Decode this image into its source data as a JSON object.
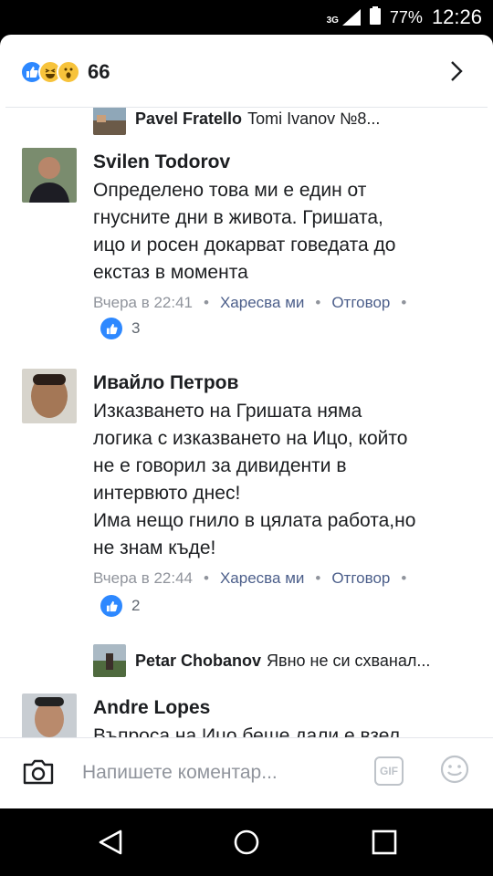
{
  "status_bar": {
    "network": "3G",
    "battery": "77%",
    "time": "12:26"
  },
  "header": {
    "reaction_count": "66",
    "reactions": [
      "like-icon",
      "haha-icon",
      "wow-icon"
    ]
  },
  "reply_previews": [
    {
      "author": "Pavel Fratello",
      "text": "Tomi Ivanov №8..."
    },
    {
      "author": "Petar Chobanov",
      "text": "Явно не си схванал..."
    }
  ],
  "comments": [
    {
      "author": "Svilen Todorov",
      "text": "Определено това ми е един от\nгнусните дни в живота. Гришата,\nицо и росен докарват говедата до\nекстаз в момента",
      "time": "Вчера в 22:41",
      "like_label": "Харесва ми",
      "reply_label": "Отговор",
      "likes": "3"
    },
    {
      "author": "Ивайло Петров",
      "text": "Изказването на Гришата няма\nлогика с изказването на Ицо, който\nне е говорил за дивиденти в\nинтервюто днес!\nИма нещо гнило в цялата работа,но\nне знам къде!",
      "time": "Вчера в 22:44",
      "like_label": "Харесва ми",
      "reply_label": "Отговор",
      "likes": "2"
    },
    {
      "author": "Andre Lopes",
      "text": "Въпроса на Ицо беше дали е взел"
    }
  ],
  "composer": {
    "placeholder": "Напишете коментар...",
    "gif_label": "GIF"
  },
  "colors": {
    "accent": "#2d88ff",
    "link": "#4b5e8a",
    "text": "#1c1e21",
    "muted": "#90949c"
  }
}
